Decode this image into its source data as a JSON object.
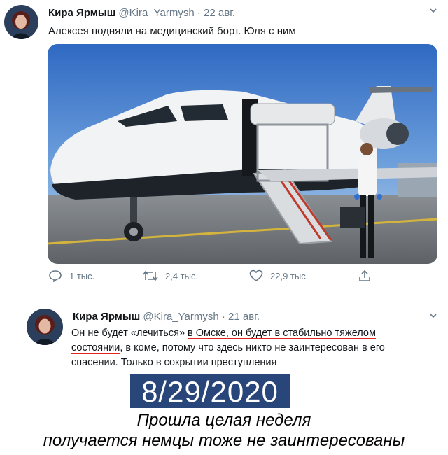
{
  "tweet1": {
    "name": "Кира Ярмыш",
    "handle": "@Kira_Yarmysh",
    "separator": "·",
    "date": "22 авг.",
    "text": "Алексея подняли на медицинский борт. Юля с ним",
    "replies": "1 тыс.",
    "retweets": "2,4 тыс.",
    "likes": "22,9 тыс."
  },
  "tweet2": {
    "name": "Кира Ярмыш",
    "handle": "@Kira_Yarmysh",
    "separator": "·",
    "date": "21 авг.",
    "text_a": "Он не будет «лечиться» ",
    "text_b": "в Омске, он будет в стабильно тяжелом состоянии",
    "text_c": ", в коме, потому что здесь никто не заинтересован в его спасении. Только в сокрытии преступления"
  },
  "overlay": {
    "date_stamp": "8/29/2020",
    "caption_line1": "Прошла целая неделя",
    "caption_line2": "получается немцы тоже не заинтересованы"
  },
  "colors": {
    "text": "#14171a",
    "secondary": "#657786",
    "underline": "#e0231c",
    "date_box": "#28467a"
  },
  "icons": [
    "reply-icon",
    "retweet-icon",
    "like-icon",
    "share-icon",
    "chevron-down-icon"
  ]
}
